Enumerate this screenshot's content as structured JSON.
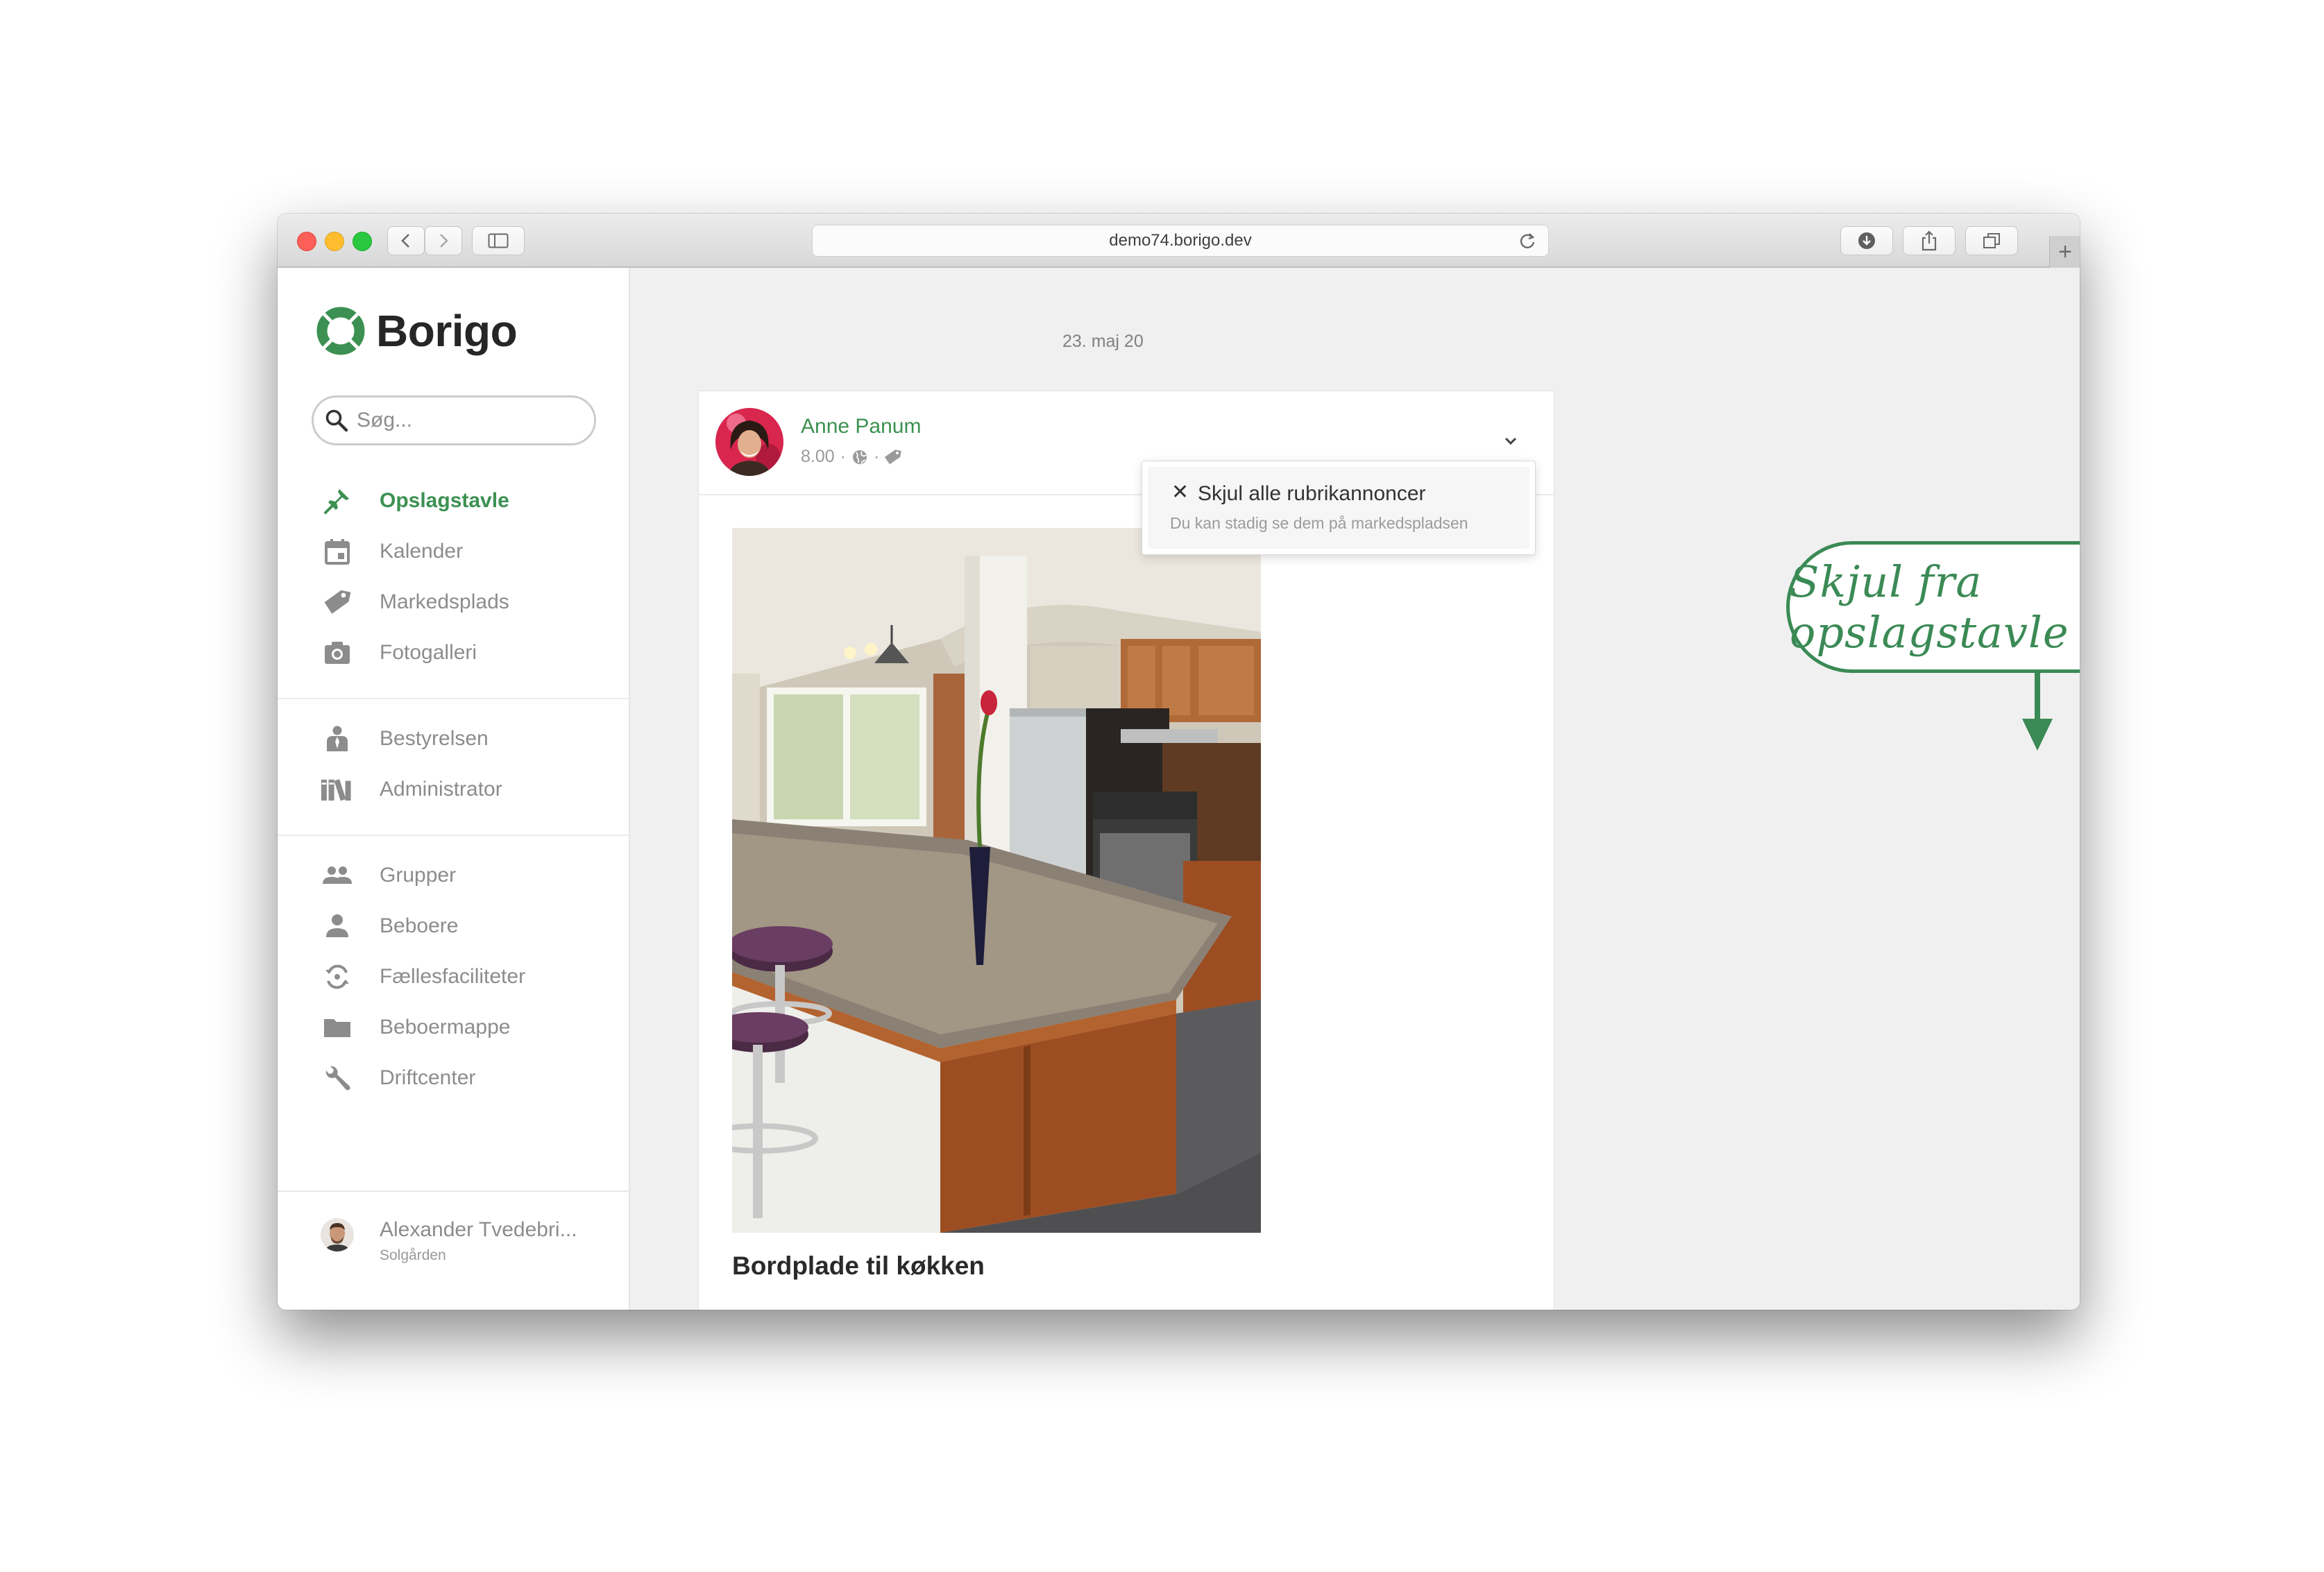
{
  "browser": {
    "url": "demo74.borigo.dev",
    "new_tab_symbol": "+"
  },
  "app": {
    "name": "Borigo",
    "brand_color": "#3c9152",
    "search_placeholder": "Søg..."
  },
  "sidebar": {
    "groups": [
      [
        {
          "label": "Opslagstavle",
          "icon": "pin-icon",
          "active": true
        },
        {
          "label": "Kalender",
          "icon": "calendar-icon",
          "active": false
        },
        {
          "label": "Markedsplads",
          "icon": "tag-icon",
          "active": false
        },
        {
          "label": "Fotogalleri",
          "icon": "camera-icon",
          "active": false
        }
      ],
      [
        {
          "label": "Bestyrelsen",
          "icon": "board-person-icon",
          "active": false
        },
        {
          "label": "Administrator",
          "icon": "books-icon",
          "active": false
        }
      ],
      [
        {
          "label": "Grupper",
          "icon": "group-icon",
          "active": false
        },
        {
          "label": "Beboere",
          "icon": "person-icon",
          "active": false
        },
        {
          "label": "Fællesfaciliteter",
          "icon": "facility-icon",
          "active": false
        },
        {
          "label": "Beboermappe",
          "icon": "folder-icon",
          "active": false
        },
        {
          "label": "Driftcenter",
          "icon": "wrench-icon",
          "active": false
        }
      ]
    ],
    "user": {
      "name": "Alexander Tvedebri...",
      "location": "Solgården"
    }
  },
  "feed": {
    "date_fragment": "23. maj 20",
    "post": {
      "author": "Anne Panum",
      "time": "8.00",
      "separator": "·",
      "title": "Bordplade til køkken"
    },
    "menu": {
      "close_symbol": "✕",
      "option_label": "Skjul alle rubrikannoncer",
      "option_hint": "Du kan stadig se dem på markedspladsen"
    }
  },
  "callout": {
    "text": "Skjul fra opslagstavle",
    "color": "#3b8a55"
  }
}
